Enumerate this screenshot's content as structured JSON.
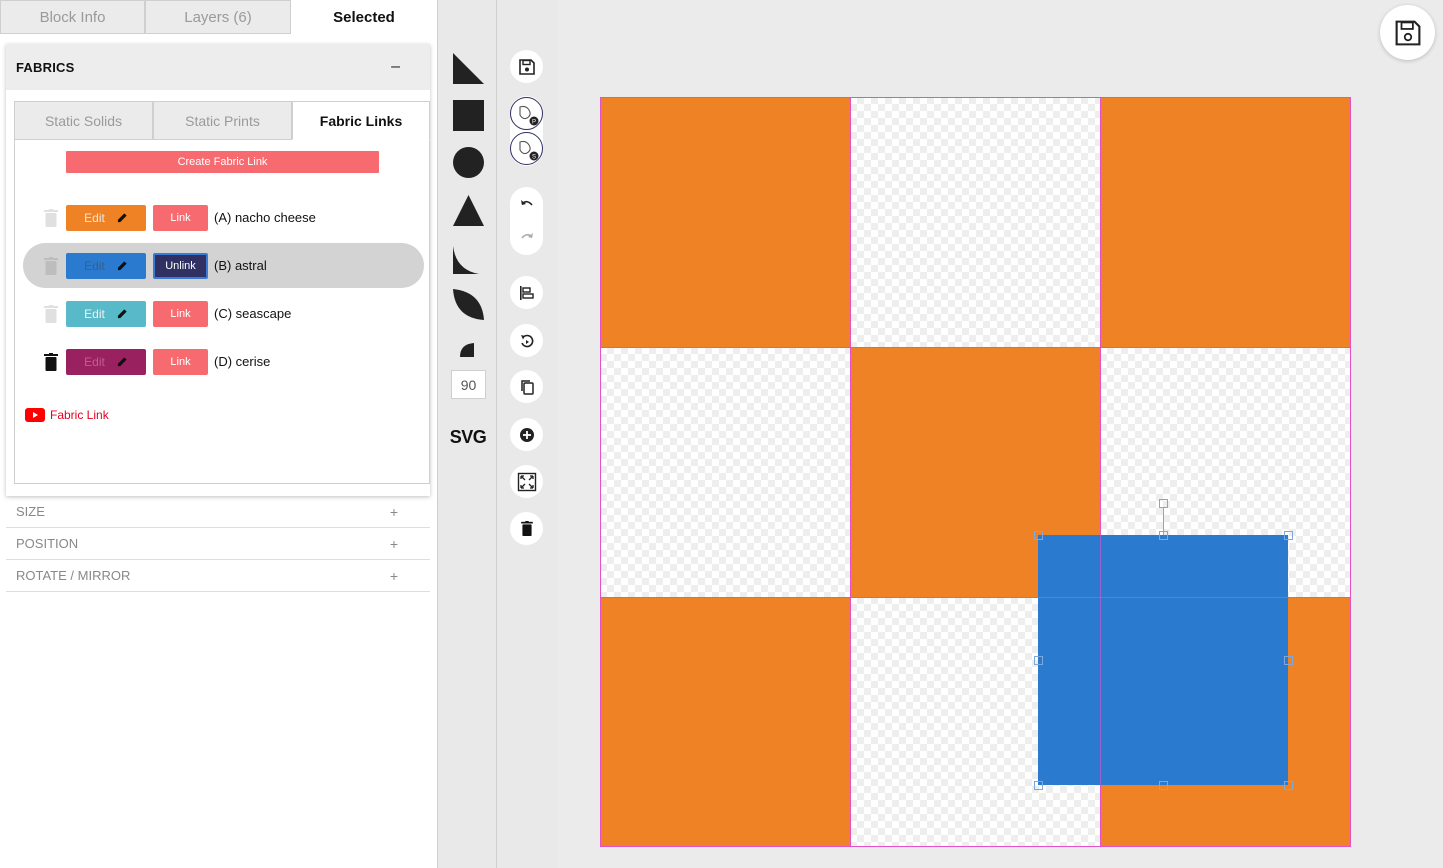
{
  "top_tabs": [
    {
      "label": "Block Info"
    },
    {
      "label": "Layers (6)"
    },
    {
      "label": "Selected"
    }
  ],
  "active_top_tab": "Selected",
  "fabrics": {
    "title": "FABRICS",
    "collapse_symbol": "–",
    "tabs": [
      {
        "label": "Static Solids"
      },
      {
        "label": "Static Prints"
      },
      {
        "label": "Fabric Links"
      }
    ],
    "active_tab": "Fabric Links",
    "create_label": "Create Fabric Link",
    "rows": [
      {
        "letter": "A",
        "name": "(A) nacho cheese",
        "edit_label": "Edit",
        "link_label": "Link",
        "color": "#f08226",
        "selected": false,
        "trash_enabled": false
      },
      {
        "letter": "B",
        "name": "(B) astral",
        "edit_label": "Edit",
        "link_label": "Unlink",
        "color": "#2a7ad0",
        "selected": true,
        "trash_enabled": false
      },
      {
        "letter": "C",
        "name": "(C) seascape",
        "edit_label": "Edit",
        "link_label": "Link",
        "color": "#58bac9",
        "selected": false,
        "trash_enabled": false
      },
      {
        "letter": "D",
        "name": "(D) cerise",
        "edit_label": "Edit",
        "link_label": "Link",
        "color": "#9a2160",
        "selected": false,
        "trash_enabled": true
      }
    ],
    "video_link_label": "Fabric Link"
  },
  "accordion": [
    {
      "label": "SIZE",
      "symbol": "+"
    },
    {
      "label": "POSITION",
      "symbol": "+"
    },
    {
      "label": "ROTATE / MIRROR",
      "symbol": "+"
    }
  ],
  "shape_tools": {
    "angle_value": "90",
    "svg_label": "SVG",
    "shapes": [
      "right-triangle",
      "square",
      "circle",
      "triangle",
      "quarter-curve",
      "leaf",
      "quarter-circle"
    ]
  },
  "tools": [
    "save-icon",
    "fabric-p-icon",
    "fabric-s-icon",
    "undo-icon",
    "redo-icon",
    "align-icon",
    "rotate-icon",
    "copy-icon",
    "add-icon",
    "fit-icon",
    "trash-icon"
  ],
  "canvas": {
    "grid": [
      [
        "orange",
        "empty",
        "orange"
      ],
      [
        "empty",
        "orange",
        "empty"
      ],
      [
        "orange",
        "empty",
        "orange"
      ]
    ],
    "fabric_color": "#f08226",
    "selected_shape_color": "#2a7ad0",
    "guide_color": "#e552c8"
  }
}
